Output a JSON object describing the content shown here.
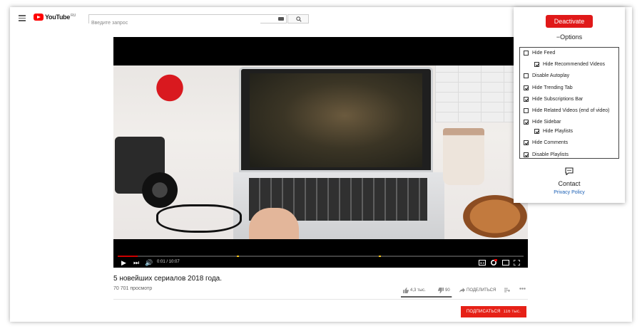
{
  "header": {
    "logo_text": "YouTube",
    "logo_region": "RU",
    "search_placeholder": "Введите запрос"
  },
  "player": {
    "time": "0:01 / 10:07",
    "progress_fraction": 0.05
  },
  "video": {
    "title": "5 новейших сериалов 2018 года.",
    "views": "70 701 просмотр",
    "likes": "4,3 тыс.",
    "dislikes": "90",
    "share_label": "ПОДЕЛИТЬСЯ",
    "like_ratio": 0.98
  },
  "subscribe": {
    "label": "ПОДПИСАТЬСЯ",
    "count": "116 тыс."
  },
  "extension": {
    "deactivate_label": "Deactivate",
    "options_title": "−Options",
    "options": [
      {
        "label": "Hide Feed",
        "checked": false,
        "indent": false
      },
      {
        "label": "Hide Recommended Videos",
        "checked": true,
        "indent": true
      },
      {
        "label": "Disable Autoplay",
        "checked": false,
        "indent": false
      },
      {
        "label": "Hide Trending Tab",
        "checked": true,
        "indent": false
      },
      {
        "label": "Hide Subscriptions Bar",
        "checked": true,
        "indent": false
      },
      {
        "label": "Hide Related Videos (end of video)",
        "checked": false,
        "indent": false
      },
      {
        "label": "Hide Sidebar",
        "checked": true,
        "indent": false
      },
      {
        "label": "Hide Playlists",
        "checked": true,
        "indent": true
      },
      {
        "label": "Hide Comments",
        "checked": true,
        "indent": false
      },
      {
        "label": "Disable Playlists",
        "checked": true,
        "indent": false
      }
    ],
    "contact_label": "Contact",
    "privacy_label": "Privacy Policy"
  },
  "colors": {
    "brand_red": "#ff0000",
    "subscribe_red": "#e62117",
    "deactivate_red": "#e01919"
  }
}
